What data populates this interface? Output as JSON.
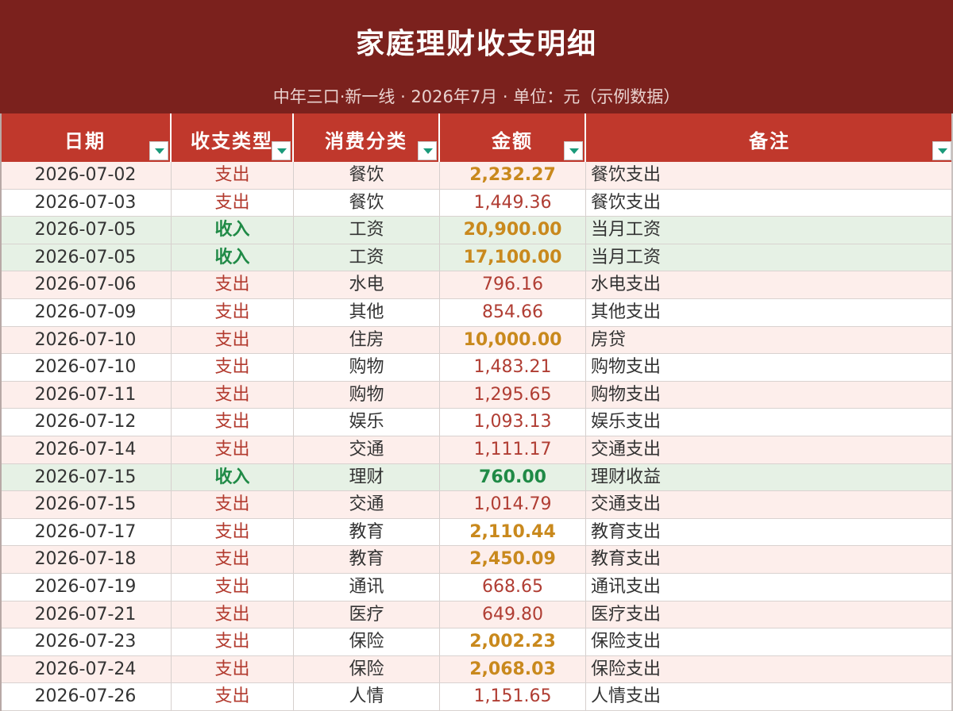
{
  "sheet": {
    "title": "家庭理财收支明细",
    "subtitle": "中年三口·新一线 · 2026年7月 · 单位：元（示例数据）"
  },
  "columns": [
    "日期",
    "收支类型",
    "消费分类",
    "金额",
    "备注"
  ],
  "colors": {
    "title_band": "#7b211d",
    "header": "#c0382c",
    "expense_row": "#fdeeeb",
    "income_row": "#e6f1e5",
    "expense_text": "#b23a2e",
    "income_text": "#1f8a46",
    "large_amount": "#c9891d",
    "filter_arrow": "#1a9a7a"
  },
  "rows": [
    {
      "date": "2026-07-02",
      "type": "支出",
      "category": "餐饮",
      "amount": "2,232.27",
      "note": "餐饮支出",
      "row_style": "exp",
      "type_style": "t-exp",
      "amount_style": "a-big"
    },
    {
      "date": "2026-07-03",
      "type": "支出",
      "category": "餐饮",
      "amount": "1,449.36",
      "note": "餐饮支出",
      "row_style": "white",
      "type_style": "t-exp",
      "amount_style": "a-exp"
    },
    {
      "date": "2026-07-05",
      "type": "收入",
      "category": "工资",
      "amount": "20,900.00",
      "note": "当月工资",
      "row_style": "inc",
      "type_style": "t-inc",
      "amount_style": "a-big"
    },
    {
      "date": "2026-07-05",
      "type": "收入",
      "category": "工资",
      "amount": "17,100.00",
      "note": "当月工资",
      "row_style": "inc",
      "type_style": "t-inc",
      "amount_style": "a-big"
    },
    {
      "date": "2026-07-06",
      "type": "支出",
      "category": "水电",
      "amount": "796.16",
      "note": "水电支出",
      "row_style": "exp",
      "type_style": "t-exp",
      "amount_style": "a-exp"
    },
    {
      "date": "2026-07-09",
      "type": "支出",
      "category": "其他",
      "amount": "854.66",
      "note": "其他支出",
      "row_style": "white",
      "type_style": "t-exp",
      "amount_style": "a-exp"
    },
    {
      "date": "2026-07-10",
      "type": "支出",
      "category": "住房",
      "amount": "10,000.00",
      "note": "房贷",
      "row_style": "exp",
      "type_style": "t-exp",
      "amount_style": "a-big"
    },
    {
      "date": "2026-07-10",
      "type": "支出",
      "category": "购物",
      "amount": "1,483.21",
      "note": "购物支出",
      "row_style": "white",
      "type_style": "t-exp",
      "amount_style": "a-exp"
    },
    {
      "date": "2026-07-11",
      "type": "支出",
      "category": "购物",
      "amount": "1,295.65",
      "note": "购物支出",
      "row_style": "exp",
      "type_style": "t-exp",
      "amount_style": "a-exp"
    },
    {
      "date": "2026-07-12",
      "type": "支出",
      "category": "娱乐",
      "amount": "1,093.13",
      "note": "娱乐支出",
      "row_style": "white",
      "type_style": "t-exp",
      "amount_style": "a-exp"
    },
    {
      "date": "2026-07-14",
      "type": "支出",
      "category": "交通",
      "amount": "1,111.17",
      "note": "交通支出",
      "row_style": "exp",
      "type_style": "t-exp",
      "amount_style": "a-exp"
    },
    {
      "date": "2026-07-15",
      "type": "收入",
      "category": "理财",
      "amount": "760.00",
      "note": "理财收益",
      "row_style": "inc",
      "type_style": "t-inc",
      "amount_style": "a-inc"
    },
    {
      "date": "2026-07-15",
      "type": "支出",
      "category": "交通",
      "amount": "1,014.79",
      "note": "交通支出",
      "row_style": "exp",
      "type_style": "t-exp",
      "amount_style": "a-exp"
    },
    {
      "date": "2026-07-17",
      "type": "支出",
      "category": "教育",
      "amount": "2,110.44",
      "note": "教育支出",
      "row_style": "white",
      "type_style": "t-exp",
      "amount_style": "a-big"
    },
    {
      "date": "2026-07-18",
      "type": "支出",
      "category": "教育",
      "amount": "2,450.09",
      "note": "教育支出",
      "row_style": "exp",
      "type_style": "t-exp",
      "amount_style": "a-big"
    },
    {
      "date": "2026-07-19",
      "type": "支出",
      "category": "通讯",
      "amount": "668.65",
      "note": "通讯支出",
      "row_style": "white",
      "type_style": "t-exp",
      "amount_style": "a-exp"
    },
    {
      "date": "2026-07-21",
      "type": "支出",
      "category": "医疗",
      "amount": "649.80",
      "note": "医疗支出",
      "row_style": "exp",
      "type_style": "t-exp",
      "amount_style": "a-exp"
    },
    {
      "date": "2026-07-23",
      "type": "支出",
      "category": "保险",
      "amount": "2,002.23",
      "note": "保险支出",
      "row_style": "white",
      "type_style": "t-exp",
      "amount_style": "a-big"
    },
    {
      "date": "2026-07-24",
      "type": "支出",
      "category": "保险",
      "amount": "2,068.03",
      "note": "保险支出",
      "row_style": "exp",
      "type_style": "t-exp",
      "amount_style": "a-big"
    },
    {
      "date": "2026-07-26",
      "type": "支出",
      "category": "人情",
      "amount": "1,151.65",
      "note": "人情支出",
      "row_style": "white",
      "type_style": "t-exp",
      "amount_style": "a-exp"
    }
  ]
}
